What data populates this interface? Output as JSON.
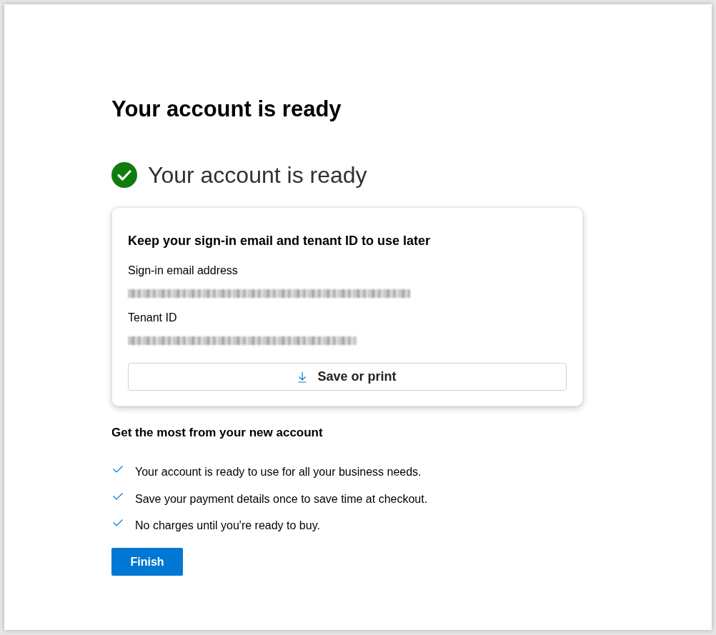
{
  "page": {
    "title": "Your account is ready"
  },
  "status": {
    "text": "Your account is ready",
    "success": true
  },
  "card": {
    "title": "Keep your sign-in email and tenant ID to use later",
    "fields": [
      {
        "label": "Sign-in email address",
        "value_blurred": true
      },
      {
        "label": "Tenant ID",
        "value_blurred": true
      }
    ],
    "save_button": {
      "label": "Save or print"
    }
  },
  "benefits": {
    "title": "Get the most from your new account",
    "items": [
      {
        "text": "Your account is ready to use for all your business needs.",
        "checked": true
      },
      {
        "text": "Save your payment details once to save time at checkout.",
        "checked": true
      },
      {
        "text": "No charges until you're ready to buy.",
        "checked": true
      }
    ]
  },
  "finish_button": {
    "label": "Finish"
  }
}
